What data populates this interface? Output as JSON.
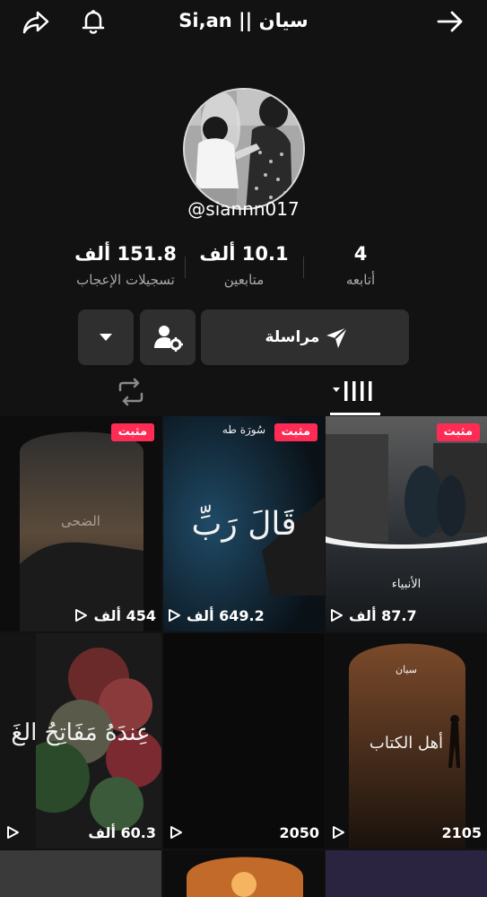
{
  "header": {
    "title": "Si,an || سيان",
    "share_icon": "share-icon",
    "bell_icon": "bell-icon",
    "forward_icon": "arrow-right-icon"
  },
  "profile": {
    "username": "@siannn017",
    "stats": [
      {
        "value": "4",
        "label": "أتابعه"
      },
      {
        "value": "10.1 ألف",
        "label": "متابعين"
      },
      {
        "value": "151.8 ألف",
        "label": "تسجيلات الإعجاب"
      }
    ]
  },
  "actions": {
    "message_label": "مراسلة",
    "message_icon": "send-icon",
    "follow_settings_icon": "user-gear-icon",
    "more_icon": "caret-down-icon"
  },
  "tabs": {
    "videos_icon": "grid-icon",
    "reposts_icon": "repost-icon"
  },
  "videos": [
    {
      "views": "87.7 ألف",
      "pinned": "مثبت",
      "caption": "الأنبياء"
    },
    {
      "views": "649.2 ألف",
      "pinned": "مثبت",
      "caption": "قَالَ رَبِّ",
      "sub": "سُورَة طه"
    },
    {
      "views": "454 ألف",
      "pinned": "مثبت",
      "caption": "الضحى"
    },
    {
      "views": "2105",
      "caption": "أهل الكتاب",
      "sub": "سيان"
    },
    {
      "views": "2050"
    },
    {
      "views": "60.3 ألف",
      "caption": "عِندَهُ مَفَاتِحُ الغَ"
    }
  ],
  "colors": {
    "background": "#121212",
    "pinned_badge": "#fe2c55",
    "button": "#2f2f2f",
    "muted_text": "#a9a9a9"
  }
}
